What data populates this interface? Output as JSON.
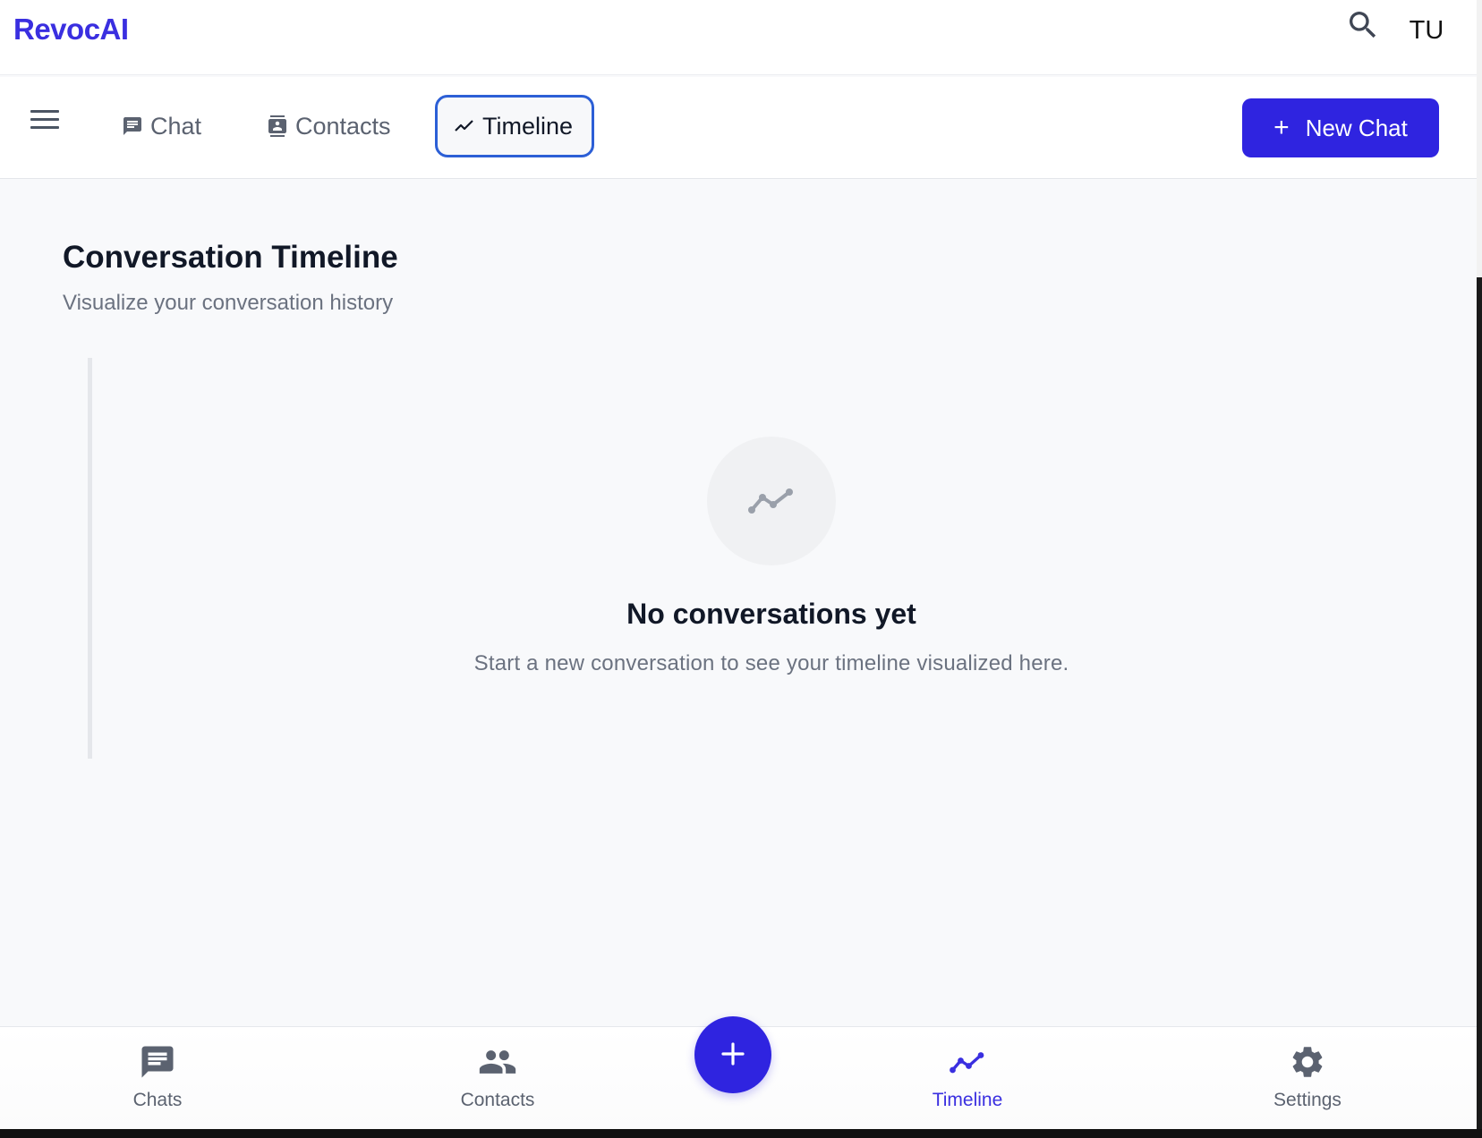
{
  "app": {
    "brand": "RevocAI",
    "user_initials": "TU"
  },
  "icons": {
    "search": "search-icon",
    "menu": "hamburger-menu-icon",
    "chat": "chat-bubble-icon",
    "contacts": "contact-card-icon",
    "timeline": "timeline-trend-icon",
    "plus": "plus-icon",
    "people": "people-icon",
    "settings": "gear-icon"
  },
  "colors": {
    "brand": "#3a2fe0",
    "primary_button": "#2f24e0",
    "active_tab_border": "#2c5fd6"
  },
  "nav": {
    "tabs": [
      {
        "label": "Chat",
        "active": false
      },
      {
        "label": "Contacts",
        "active": false
      },
      {
        "label": "Timeline",
        "active": true
      }
    ],
    "new_chat_icon": "+",
    "new_chat_label": "New Chat"
  },
  "main": {
    "title": "Conversation Timeline",
    "subtitle": "Visualize your conversation history",
    "empty_state": {
      "title": "No conversations yet",
      "description": "Start a new conversation to see your timeline visualized here."
    }
  },
  "bottom_nav": {
    "items": [
      {
        "label": "Chats",
        "active": false
      },
      {
        "label": "Contacts",
        "active": false
      },
      {
        "label": "Timeline",
        "active": true
      },
      {
        "label": "Settings",
        "active": false
      }
    ],
    "fab_label": "+"
  }
}
